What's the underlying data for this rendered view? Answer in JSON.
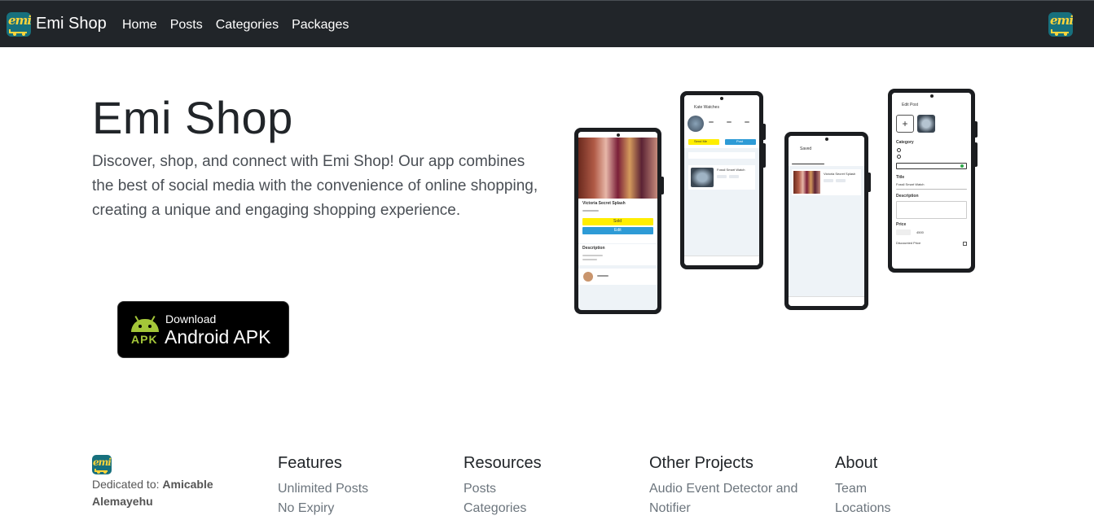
{
  "navbar": {
    "brand": "Emi Shop",
    "links": [
      "Home",
      "Posts",
      "Categories",
      "Packages"
    ]
  },
  "hero": {
    "title": "Emi Shop",
    "description": "Discover, shop, and connect with Emi Shop! Our app combines the best of social media with the convenience of online shopping, creating a unique and engaging shopping experience.",
    "download": {
      "small": "Download",
      "big": "Android APK",
      "badge": "APK"
    }
  },
  "screens": {
    "phone1": {
      "title": "Victoria Secret Splash",
      "btn1": "Sold",
      "btn2": "Edit",
      "section": "Description"
    },
    "phone2": {
      "title": "Kate Watches",
      "btn1": "Send Me",
      "btn2": "Post",
      "item": "Fossil Smart Watch"
    },
    "phone3": {
      "title": "Saved",
      "item": "Victoria Secret Splash"
    },
    "phone4": {
      "title": "Edit Post",
      "f1": "Category",
      "f2": "Title",
      "f3": "Description",
      "f4": "Price",
      "f5": "Discounted Price",
      "title_value": "Fossil Smart Watch",
      "price_value": "4500"
    }
  },
  "footer": {
    "dedicated_label": "Dedicated to: ",
    "dedicated_name": "Amicable Alemayehu",
    "columns": [
      {
        "title": "Features",
        "links": [
          "Unlimited Posts",
          "No Expiry"
        ]
      },
      {
        "title": "Resources",
        "links": [
          "Posts",
          "Categories"
        ]
      },
      {
        "title": "Other Projects",
        "links": [
          "Audio Event Detector and Notifier"
        ]
      },
      {
        "title": "About",
        "links": [
          "Team",
          "Locations"
        ]
      }
    ]
  },
  "colors": {
    "navbar": "#212529",
    "logo_bg": "#17707d",
    "logo_fg": "#ffd43b",
    "android_green": "#a4c639"
  }
}
